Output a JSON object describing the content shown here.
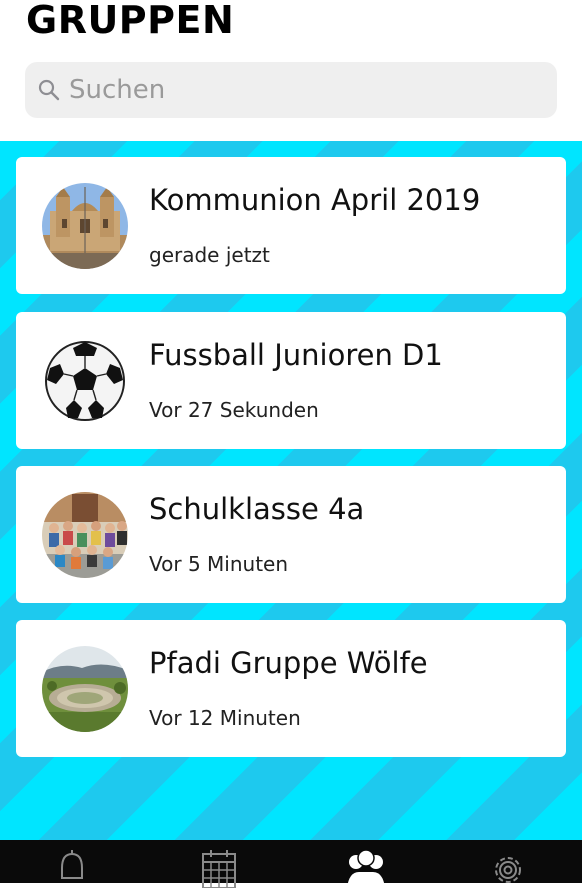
{
  "header": {
    "title": "GRUPPEN"
  },
  "search": {
    "placeholder": "Suchen",
    "value": "",
    "icon": "search-icon"
  },
  "colors": {
    "stripe_light": "#00e5ff",
    "stripe_dark": "#1ec9ee",
    "card": "#ffffff",
    "tabbar": "#0a0a0a"
  },
  "groups": [
    {
      "name": "Kommunion April 2019",
      "time": "gerade jetzt",
      "avatar": "church-photo"
    },
    {
      "name": "Fussball Junioren D1",
      "time": "Vor 27 Sekunden",
      "avatar": "soccer-ball-photo"
    },
    {
      "name": "Schulklasse 4a",
      "time": "Vor 5 Minuten",
      "avatar": "class-photo"
    },
    {
      "name": "Pfadi Gruppe Wölfe",
      "time": "Vor 12 Minuten",
      "avatar": "amphitheater-photo"
    }
  ],
  "tabbar": {
    "tabs": [
      {
        "icon": "bell-icon",
        "active": false
      },
      {
        "icon": "calendar-icon",
        "active": false
      },
      {
        "icon": "people-icon",
        "active": true
      },
      {
        "icon": "gear-icon",
        "active": false
      }
    ]
  }
}
